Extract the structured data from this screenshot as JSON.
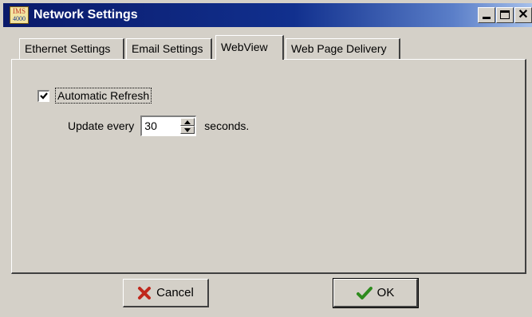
{
  "window": {
    "title": "Network Settings",
    "app_icon_text_top": "IMS",
    "app_icon_text_bottom": "4000",
    "close_glyph": "✕"
  },
  "tabs": [
    {
      "label": "Ethernet Settings",
      "active": false
    },
    {
      "label": "Email Settings",
      "active": false
    },
    {
      "label": "WebView",
      "active": true
    },
    {
      "label": "Web Page Delivery",
      "active": false
    }
  ],
  "webview": {
    "auto_refresh_label": "Automatic Refresh",
    "auto_refresh_checked": true,
    "update_prefix": "Update every",
    "update_value": "30",
    "update_suffix": "seconds."
  },
  "buttons": {
    "cancel_label": "Cancel",
    "ok_label": "OK"
  },
  "icons": {
    "cancel": "red-x-icon",
    "ok": "green-check-icon"
  },
  "colors": {
    "titlebar_dark": "#0a1a6a",
    "titlebar_light": "#a6c0ea",
    "face": "#d4d0c8",
    "cancel_icon": "#c0281c",
    "ok_icon": "#2e8b1e"
  }
}
